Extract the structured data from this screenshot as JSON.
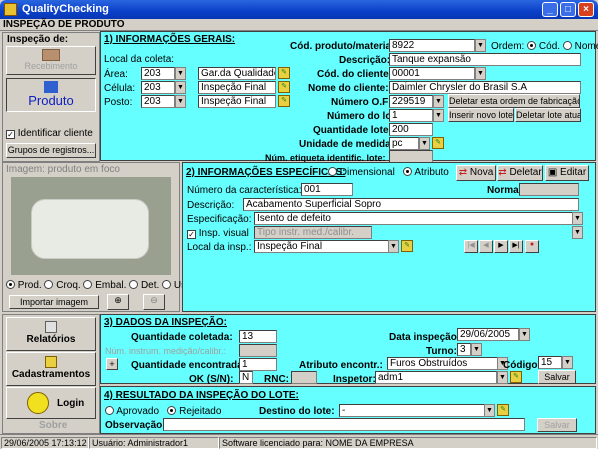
{
  "window": {
    "title": "QualityChecking"
  },
  "topbar": {
    "label": "INSPEÇÃO DE PRODUTO"
  },
  "side": {
    "header": "Inspeção de:",
    "btn_recebimento": "Recebimento",
    "btn_produto": "Produto",
    "identificar": "Identificar cliente",
    "grupos": "Grupos de registros...",
    "img_label": "Imagem: produto em foco",
    "radios": [
      "Prod.",
      "Croq.",
      "Embal.",
      "Det.",
      "Uso"
    ],
    "importar": "Importar imagem",
    "relatorios": "Relatórios",
    "cadastramentos": "Cadastramentos",
    "login": "Login",
    "sobre": "Sobre"
  },
  "info": {
    "title": "1) INFORMAÇÕES GERAIS:",
    "local": "Local da coleta:",
    "area_lbl": "Área:",
    "celula_lbl": "Célula:",
    "posto_lbl": "Posto:",
    "area_code": "203",
    "celula_code": "203",
    "posto_code": "203",
    "area_name": "Gar.da Qualidade",
    "celula_name": "Inspeção Final",
    "posto_name": "Inspeção Final",
    "cod_prod_lbl": "Cód. produto/material:",
    "cod_prod": "8922",
    "ordem_lbl": "Ordem:",
    "ord_cod": "Cód.",
    "ord_nome": "Nome",
    "descricao_lbl": "Descrição:",
    "descricao": "Tanque expansão",
    "cod_cliente_lbl": "Cód. do cliente:",
    "cod_cliente": "00001",
    "nome_cliente_lbl": "Nome do cliente:",
    "nome_cliente": "Daimler Chrysler do Brasil S.A",
    "numero_of_lbl": "Número O.F:",
    "numero_of": "229519",
    "deletar_of": "Deletar esta ordem de fabricação",
    "numero_lote_lbl": "Número do lote:",
    "numero_lote": "1",
    "inserir_lote": "Inserir novo lote",
    "deletar_lote": "Deletar lote atual",
    "qtd_lote_lbl": "Quantidade lote:",
    "qtd_lote": "200",
    "unidade_lbl": "Unidade de medida:",
    "unidade": "pc",
    "etiqueta_lbl": "Núm. etiqueta identific. lote:"
  },
  "spec": {
    "title": "2) INFORMAÇÕES ESPECÍFICAS:",
    "dimensional": "Dimensional",
    "atributo": "Atributo",
    "nova": "Nova",
    "deletar": "Deletar",
    "editar": "Editar",
    "num_car_lbl": "Número da característica:",
    "num_car": "001",
    "norma_lbl": "Norma:",
    "descricao_lbl": "Descrição:",
    "descricao": "Acabamento Superficial Sopro",
    "especificacao_lbl": "Especificação:",
    "especificacao": "Isento de defeito",
    "insp_visual": "Insp. visual",
    "tipo_instr": "Tipo instr. med./calibr.",
    "local_insp_lbl": "Local da insp.:",
    "local_insp": "Inspeção Final"
  },
  "dados": {
    "title": "3) DADOS DA INSPEÇÃO:",
    "qtd_coletada_lbl": "Quantidade coletada:",
    "qtd_coletada": "13",
    "num_instr_lbl": "Núm. instrum. medição/calibr.:",
    "qtd_encontrada_lbl": "Quantidade encontrada:",
    "qtd_encontrada": "1",
    "ok_lbl": "OK (S/N):",
    "ok": "N",
    "rnc_lbl": "RNC:",
    "data_lbl": "Data inspeção:",
    "data": "29/06/2005",
    "turno_lbl": "Turno:",
    "turno": "3",
    "atributo_lbl": "Atributo encontr.:",
    "atributo": "Furos Obstruídos",
    "codigo_lbl": "Código:",
    "codigo": "15",
    "inspetor_lbl": "Inspetor:",
    "inspetor": "adm1",
    "salvar": "Salvar"
  },
  "resultado": {
    "title": "4) RESULTADO DA INSPEÇÃO DO LOTE:",
    "aprovado": "Aprovado",
    "rejeitado": "Rejeitado",
    "destino_lbl": "Destino do lote:",
    "destino": "-",
    "observacao_lbl": "Observação:",
    "salvar": "Salvar"
  },
  "status": {
    "datetime": "29/06/2005  17:13:12",
    "usuario": "Usuário: Administrador1",
    "licenca": "Software licenciado para: NOME DA EMPRESA"
  }
}
